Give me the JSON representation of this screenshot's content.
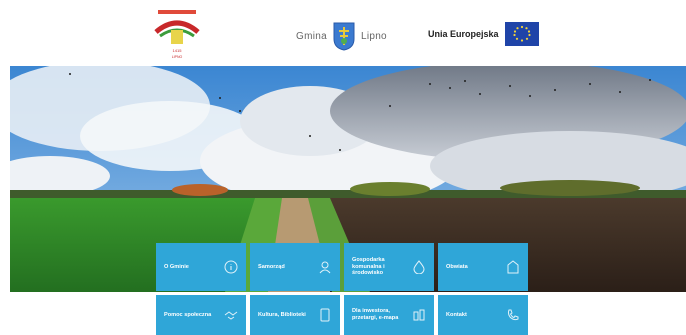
{
  "header": {
    "logo_left_text": "Gmina Lipno",
    "gmina_left": "Gmina",
    "gmina_right": "Lipno",
    "ue_label": "Unia Europejska"
  },
  "tiles": [
    {
      "label": "O Gminie",
      "icon": "info-icon"
    },
    {
      "label": "Samorząd",
      "icon": "user-icon"
    },
    {
      "label": "Gospodarka komunalna i środowisko",
      "icon": "drop-icon"
    },
    {
      "label": "Obwiata",
      "icon": "document-icon"
    },
    {
      "label": "Pomoc społeczna",
      "icon": "handshake-icon"
    },
    {
      "label": "Kultura, Biblioteki",
      "icon": "book-icon"
    },
    {
      "label": "Dla inwestora, przetargi, e-mapa",
      "icon": "map-icon"
    },
    {
      "label": "Kontakt",
      "icon": "phone-icon"
    }
  ],
  "colors": {
    "tile_bg": "#2fa6d8",
    "sky": "#3f8fd6",
    "field_green": "#2f8a2a",
    "field_soil": "#3a2a1f"
  }
}
